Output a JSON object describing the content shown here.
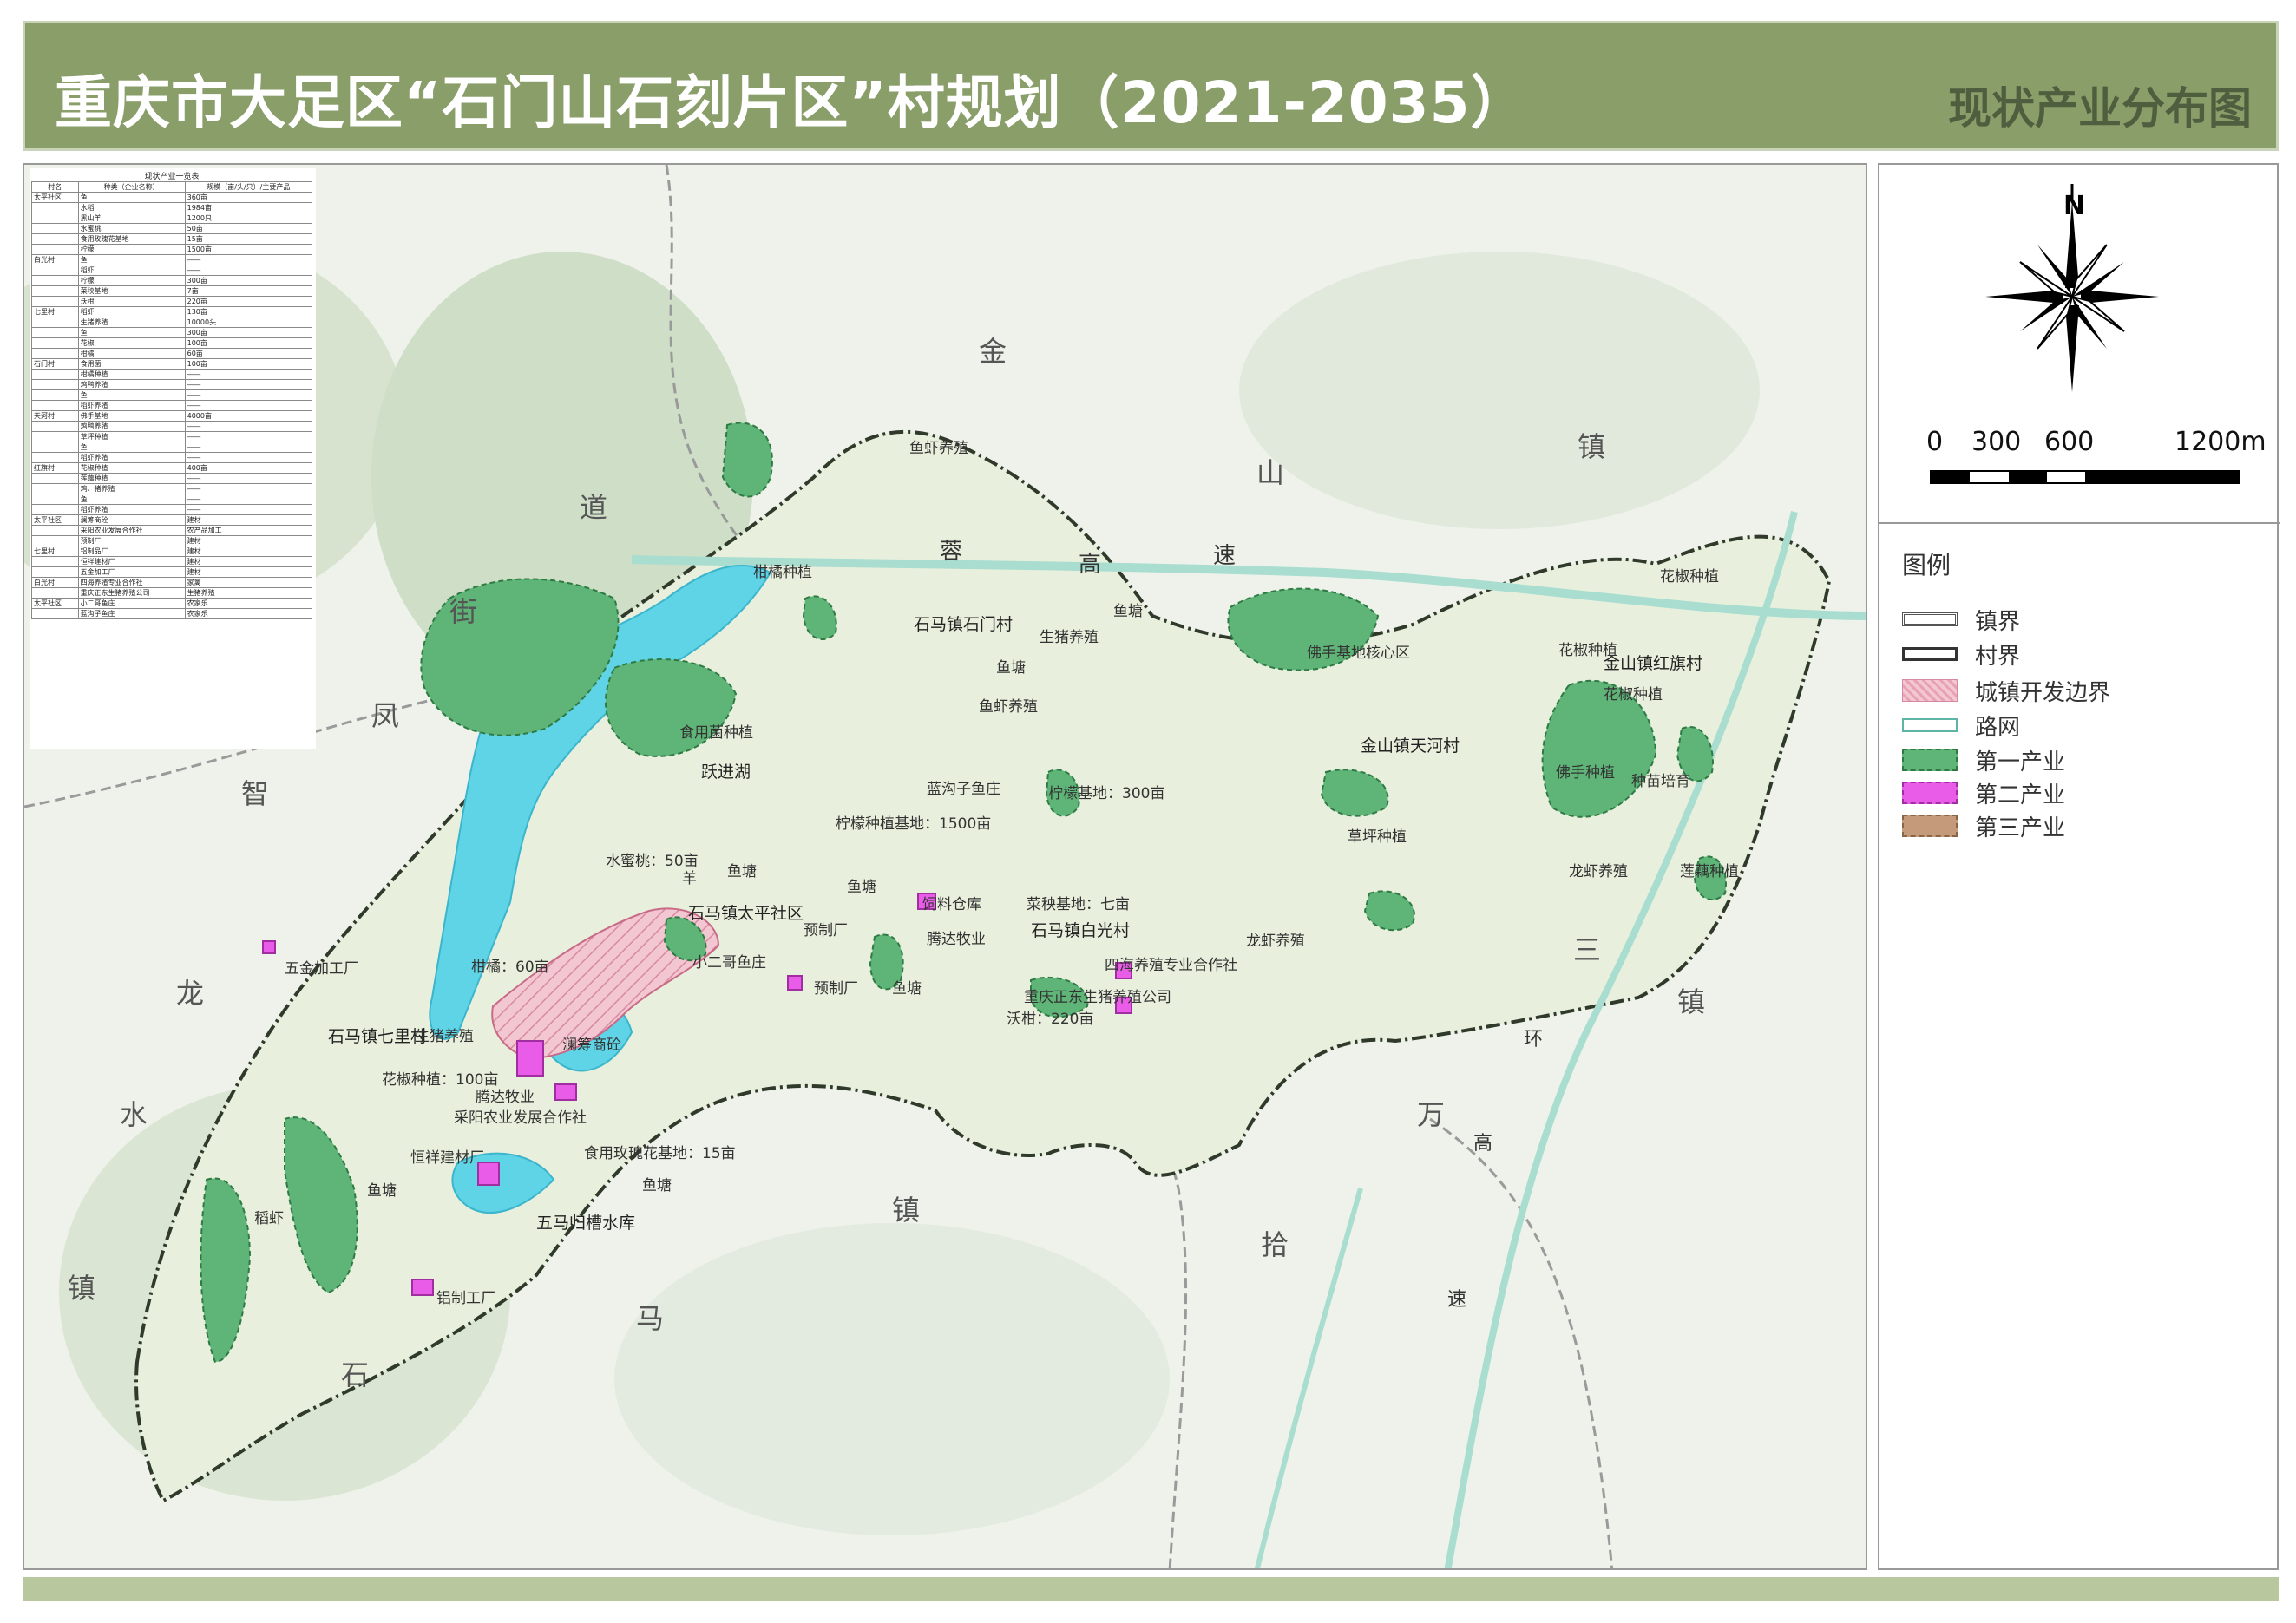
{
  "header": {
    "title": "重庆市大足区“石门山石刻片区”村规划（2021-2035）",
    "subtitle": "现状产业分布图"
  },
  "compass": {
    "north": "N"
  },
  "scale_bar": {
    "labels": [
      "0",
      "300",
      "600",
      "1200m"
    ]
  },
  "legend": {
    "title": "图例",
    "items": [
      {
        "label": "镇界",
        "color": "#555555"
      },
      {
        "label": "村界",
        "color": "#333333"
      },
      {
        "label": "城镇开发边界",
        "color": "#e8b4c0"
      },
      {
        "label": "路网",
        "color": "#8fd3c7"
      },
      {
        "label": "第一产业",
        "color": "#5fb577"
      },
      {
        "label": "第二产业",
        "color": "#e85ce8"
      },
      {
        "label": "第三产业",
        "color": "#c49a7a"
      }
    ]
  },
  "table": {
    "caption": "现状产业一览表",
    "headers": [
      "村名",
      "种类（企业名称）",
      "规模（亩/头/只）/主要产品"
    ],
    "rows": [
      [
        "太平社区",
        "鱼",
        "360亩"
      ],
      [
        "",
        "水稻",
        "1984亩"
      ],
      [
        "",
        "黑山羊",
        "1200只"
      ],
      [
        "",
        "水蜜桃",
        "50亩"
      ],
      [
        "",
        "食用玫瑰花基地",
        "15亩"
      ],
      [
        "",
        "柠檬",
        "1500亩"
      ],
      [
        "白光村",
        "鱼",
        "——"
      ],
      [
        "",
        "稻虾",
        "——"
      ],
      [
        "",
        "柠檬",
        "300亩"
      ],
      [
        "",
        "菜秧基地",
        "7亩"
      ],
      [
        "",
        "沃柑",
        "220亩"
      ],
      [
        "七里村",
        "稻虾",
        "130亩"
      ],
      [
        "",
        "生猪养殖",
        "10000头"
      ],
      [
        "",
        "鱼",
        "300亩"
      ],
      [
        "",
        "花椒",
        "100亩"
      ],
      [
        "",
        "柑橘",
        "60亩"
      ],
      [
        "石门村",
        "食用菌",
        "100亩"
      ],
      [
        "",
        "柑橘种植",
        "——"
      ],
      [
        "",
        "鸡鸭养殖",
        "——"
      ],
      [
        "",
        "鱼",
        "——"
      ],
      [
        "",
        "稻虾养殖",
        "——"
      ],
      [
        "天河村",
        "佛手基地",
        "4000亩"
      ],
      [
        "",
        "鸡鸭养殖",
        "——"
      ],
      [
        "",
        "草坪种植",
        "——"
      ],
      [
        "",
        "鱼",
        "——"
      ],
      [
        "",
        "稻虾养殖",
        "——"
      ],
      [
        "红旗村",
        "花椒种植",
        "400亩"
      ],
      [
        "",
        "莲藕种植",
        "——"
      ],
      [
        "",
        "鸡、猪养殖",
        "——"
      ],
      [
        "",
        "鱼",
        "——"
      ],
      [
        "",
        "稻虾养殖",
        "——"
      ],
      [
        "太平社区",
        "澜筹商砼",
        "建材"
      ],
      [
        "",
        "采阳农业发展合作社",
        "农产品加工"
      ],
      [
        "",
        "预制厂",
        "建材"
      ],
      [
        "七里村",
        "铝制品厂",
        "建材"
      ],
      [
        "",
        "恒祥建材厂",
        "建材"
      ],
      [
        "",
        "五金加工厂",
        "建材"
      ],
      [
        "白光村",
        "四海养殖专业合作社",
        "家禽"
      ],
      [
        "",
        "重庆正东生猪养殖公司",
        "生猪养殖"
      ],
      [
        "太平社区",
        "小二哥鱼庄",
        "农家乐"
      ],
      [
        "",
        "蓝沟子鱼庄",
        "农家乐"
      ]
    ]
  },
  "map": {
    "town_labels": [
      "金",
      "山",
      "镇",
      "道",
      "街",
      "凤",
      "智",
      "龙",
      "水",
      "镇",
      "石",
      "马",
      "镇",
      "三",
      "镇",
      "环",
      "万",
      "高",
      "拾",
      "速",
      "蓉",
      "高",
      "速"
    ],
    "village_labels": [
      "石马镇石门村",
      "石马镇太平社区",
      "石马镇白光村",
      "石马镇七里村",
      "金山镇天河村",
      "金山镇红旗村",
      "跃进湖",
      "五马归槽水库"
    ],
    "place_labels": [
      "鱼虾养殖",
      "柑橘种植",
      "鱼塘",
      "生猪养殖",
      "鱼塘",
      "鱼虾养殖",
      "食用菌种植",
      "柠檬种植基地：1500亩",
      "蓝沟子鱼庄",
      "柠檬基地：300亩",
      "水蜜桃：50亩",
      "羊",
      "鱼塘",
      "鱼塘",
      "饲料仓库",
      "菜秧基地：七亩",
      "预制厂",
      "腾达牧业",
      "柑橘：60亩",
      "五金加工厂",
      "小二哥鱼庄",
      "四海养殖专业合作社",
      "重庆正东生猪养殖公司",
      "沃柑：220亩",
      "预制厂",
      "鱼塘",
      "鱼塘",
      "生猪养殖",
      "澜筹商砼",
      "花椒种植：100亩",
      "腾达牧业",
      "采阳农业发展合作社",
      "恒祥建材厂",
      "食用玫瑰花基地：15亩",
      "鱼塘",
      "稻虾",
      "铝制工厂",
      "佛手基地核心区",
      "花椒种植",
      "花椒种植",
      "花椒种植",
      "佛手种植",
      "种苗培育",
      "草坪种植",
      "龙虾养殖",
      "莲藕种植",
      "龙虾养殖"
    ]
  }
}
